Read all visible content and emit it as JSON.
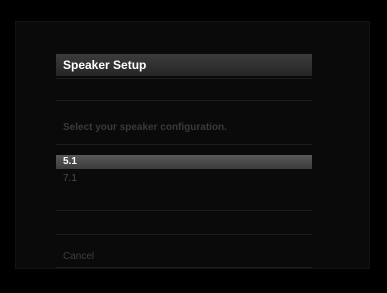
{
  "dialog": {
    "title": "Speaker Setup",
    "prompt": "Select your speaker configuration.",
    "options": [
      {
        "label": "5.1",
        "selected": true
      },
      {
        "label": "7.1",
        "selected": false
      }
    ],
    "cancel_label": "Cancel"
  },
  "colors": {
    "background": "#000000",
    "title_bar": "#3c3c3c",
    "highlight": "#585858",
    "text_primary": "#ffffff",
    "text_dim": "#3a3a3a"
  }
}
